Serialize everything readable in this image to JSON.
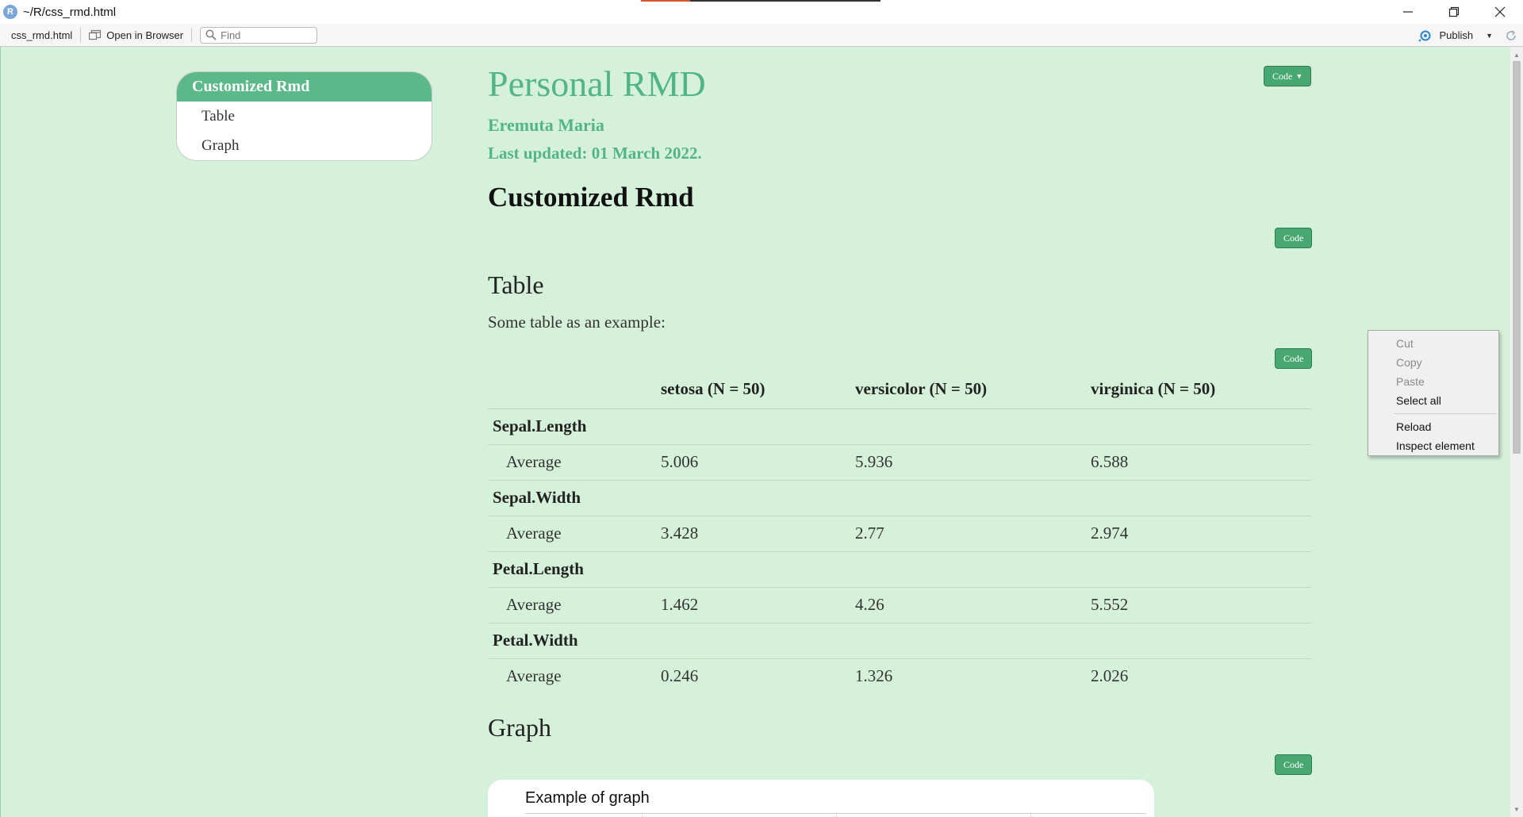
{
  "window": {
    "title": "~/R/css_rmd.html",
    "logo_letter": "R"
  },
  "toolbar": {
    "file_name": "css_rmd.html",
    "open_in_browser": "Open in Browser",
    "find_placeholder": "Find",
    "publish": "Publish"
  },
  "toc": {
    "items": [
      "Customized Rmd",
      "Table",
      "Graph"
    ],
    "active": "Customized Rmd"
  },
  "doc": {
    "title": "Personal RMD",
    "author": "Eremuta Maria",
    "date": "Last updated: 01 March 2022.",
    "section_main": "Customized Rmd",
    "section_table": "Table",
    "table_intro": "Some table as an example:",
    "section_graph": "Graph",
    "graph_title": "Example of graph",
    "code_all_label": "Code",
    "code_label": "Code"
  },
  "table": {
    "headers": [
      "",
      "setosa (N = 50)",
      "versicolor (N = 50)",
      "virginica (N = 50)"
    ],
    "groups": [
      {
        "name": "Sepal.Length",
        "stat": "Average",
        "values": [
          "5.006",
          "5.936",
          "6.588"
        ]
      },
      {
        "name": "Sepal.Width",
        "stat": "Average",
        "values": [
          "3.428",
          "2.77",
          "2.974"
        ]
      },
      {
        "name": "Petal.Length",
        "stat": "Average",
        "values": [
          "1.462",
          "4.26",
          "5.552"
        ]
      },
      {
        "name": "Petal.Width",
        "stat": "Average",
        "values": [
          "0.246",
          "1.326",
          "2.026"
        ]
      }
    ]
  },
  "context_menu": {
    "cut": "Cut",
    "copy": "Copy",
    "paste": "Paste",
    "select_all": "Select all",
    "reload": "Reload",
    "inspect": "Inspect element"
  },
  "colors": {
    "page_background": "#d6f1da",
    "accent_green": "#52b488",
    "button_green": "#47a871"
  }
}
